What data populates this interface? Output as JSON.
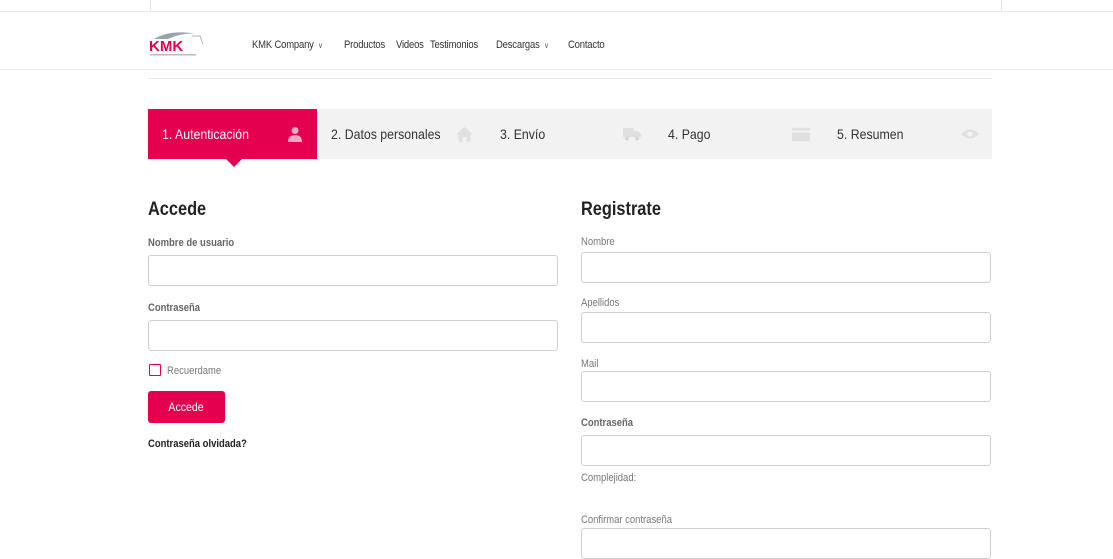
{
  "brand": {
    "logo_text": "KMK",
    "accent": "#e5004f"
  },
  "nav": {
    "items": [
      {
        "label": "KMK Company",
        "has_dropdown": true
      },
      {
        "label": "Productos",
        "has_dropdown": false
      },
      {
        "label": "Videos",
        "has_dropdown": false
      },
      {
        "label": "Testimonios",
        "has_dropdown": false
      },
      {
        "label": "Descargas",
        "has_dropdown": true
      },
      {
        "label": "Contacto",
        "has_dropdown": false
      }
    ]
  },
  "steps": [
    {
      "label": "1. Autenticación",
      "icon": "user-icon",
      "active": true
    },
    {
      "label": "2. Datos personales",
      "icon": "home-icon",
      "active": false
    },
    {
      "label": "3. Envío",
      "icon": "truck-icon",
      "active": false
    },
    {
      "label": "4. Pago",
      "icon": "credit-card-icon",
      "active": false
    },
    {
      "label": "5. Resumen",
      "icon": "eye-icon",
      "active": false
    }
  ],
  "login": {
    "title": "Accede",
    "username_label": "Nombre de usuario",
    "username_value": "",
    "password_label": "Contraseña",
    "password_value": "",
    "remember_label": "Recuerdame",
    "remember_checked": false,
    "submit_label": "Accede",
    "forgot_label": "Contraseña olvidada?"
  },
  "register": {
    "title": "Registrate",
    "name_label": "Nombre",
    "surname_label": "Apellidos",
    "mail_label": "Mail",
    "password_label": "Contraseña",
    "complexity_label": "Complejidad:",
    "confirm_label": "Confirmar contraseña"
  }
}
